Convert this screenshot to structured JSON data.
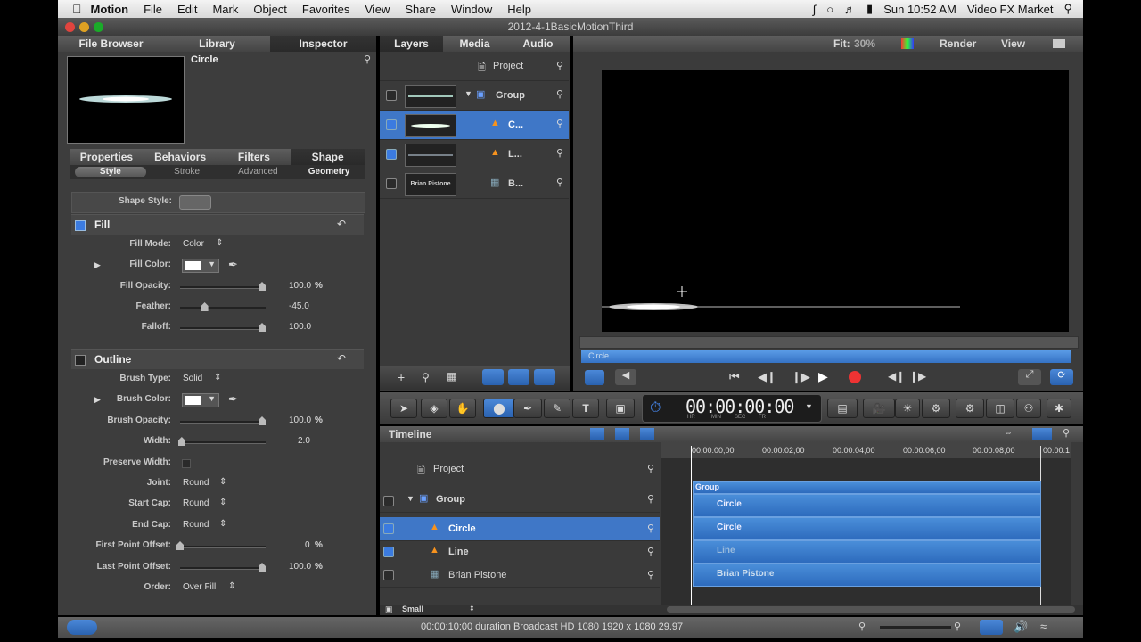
{
  "menubar": {
    "app": "Motion",
    "items": [
      "File",
      "Edit",
      "Mark",
      "Object",
      "Favorites",
      "View",
      "Share",
      "Window",
      "Help"
    ],
    "clock": "Sun 10:52 AM",
    "user": "Video FX Market"
  },
  "window": {
    "title": "2012-4-1BasicMotionThird"
  },
  "left_tabs": [
    "File Browser",
    "Library",
    "Inspector"
  ],
  "preview": {
    "name": "Circle"
  },
  "inspector_tabs": [
    "Properties",
    "Behaviors",
    "Filters",
    "Shape"
  ],
  "shape_subtabs": [
    "Style",
    "Stroke",
    "Advanced",
    "Geometry"
  ],
  "shape_style_label": "Shape Style:",
  "fill": {
    "title": "Fill",
    "mode_label": "Fill Mode:",
    "mode_value": "Color",
    "color_label": "Fill Color:",
    "opacity_label": "Fill Opacity:",
    "opacity_value": "100.0",
    "opacity_unit": "%",
    "opacity_level": 1.0,
    "feather_label": "Feather:",
    "feather_value": "-45.0",
    "feather_level": 0.3,
    "falloff_label": "Falloff:",
    "falloff_value": "100.0",
    "falloff_level": 1.0
  },
  "outline": {
    "title": "Outline",
    "brush_type_label": "Brush Type:",
    "brush_type_value": "Solid",
    "brush_color_label": "Brush Color:",
    "brush_opacity_label": "Brush Opacity:",
    "brush_opacity_value": "100.0",
    "brush_opacity_unit": "%",
    "brush_opacity_level": 1.0,
    "width_label": "Width:",
    "width_value": "2.0",
    "width_level": 0.02,
    "preserve_label": "Preserve Width:",
    "joint_label": "Joint:",
    "joint_value": "Round",
    "start_cap_label": "Start Cap:",
    "start_cap_value": "Round",
    "end_cap_label": "End Cap:",
    "end_cap_value": "Round",
    "first_offset_label": "First Point Offset:",
    "first_offset_value": "0",
    "first_offset_unit": "%",
    "first_offset_level": 0.0,
    "last_offset_label": "Last Point Offset:",
    "last_offset_value": "100.0",
    "last_offset_unit": "%",
    "last_offset_level": 1.0,
    "order_label": "Order:",
    "order_value": "Over Fill"
  },
  "layer_tabs": [
    "Layers",
    "Media",
    "Audio"
  ],
  "layers": {
    "project": "Project",
    "group": "Group",
    "circle": "C...",
    "line": "L...",
    "brian_thumb": "Brian Pistone",
    "brian": "B..."
  },
  "canvas_toolbar": {
    "fit_label": "Fit:",
    "fit_value": "30%",
    "render": "Render",
    "view": "View"
  },
  "canvas_clip": "Circle",
  "timecode": {
    "value": "00:00:00:00",
    "units": [
      "HR",
      "MIN",
      "SEC",
      "FR"
    ]
  },
  "timeline": {
    "title": "Timeline",
    "rows": {
      "project": "Project",
      "group": "Group",
      "circle": "Circle",
      "line": "Line",
      "brian": "Brian Pistone"
    },
    "ruler": [
      "00:00:00;00",
      "00:00:02;00",
      "00:00:04;00",
      "00:00:06;00",
      "00:00:08;00",
      "00:00:1"
    ],
    "bars": {
      "group": "Group",
      "circle1": "Circle",
      "circle2": "Circle",
      "line": "Line",
      "brian": "Brian Pistone"
    },
    "size": "Small"
  },
  "status": "00:00:10;00 duration Broadcast HD 1080 1920 x 1080 29.97"
}
